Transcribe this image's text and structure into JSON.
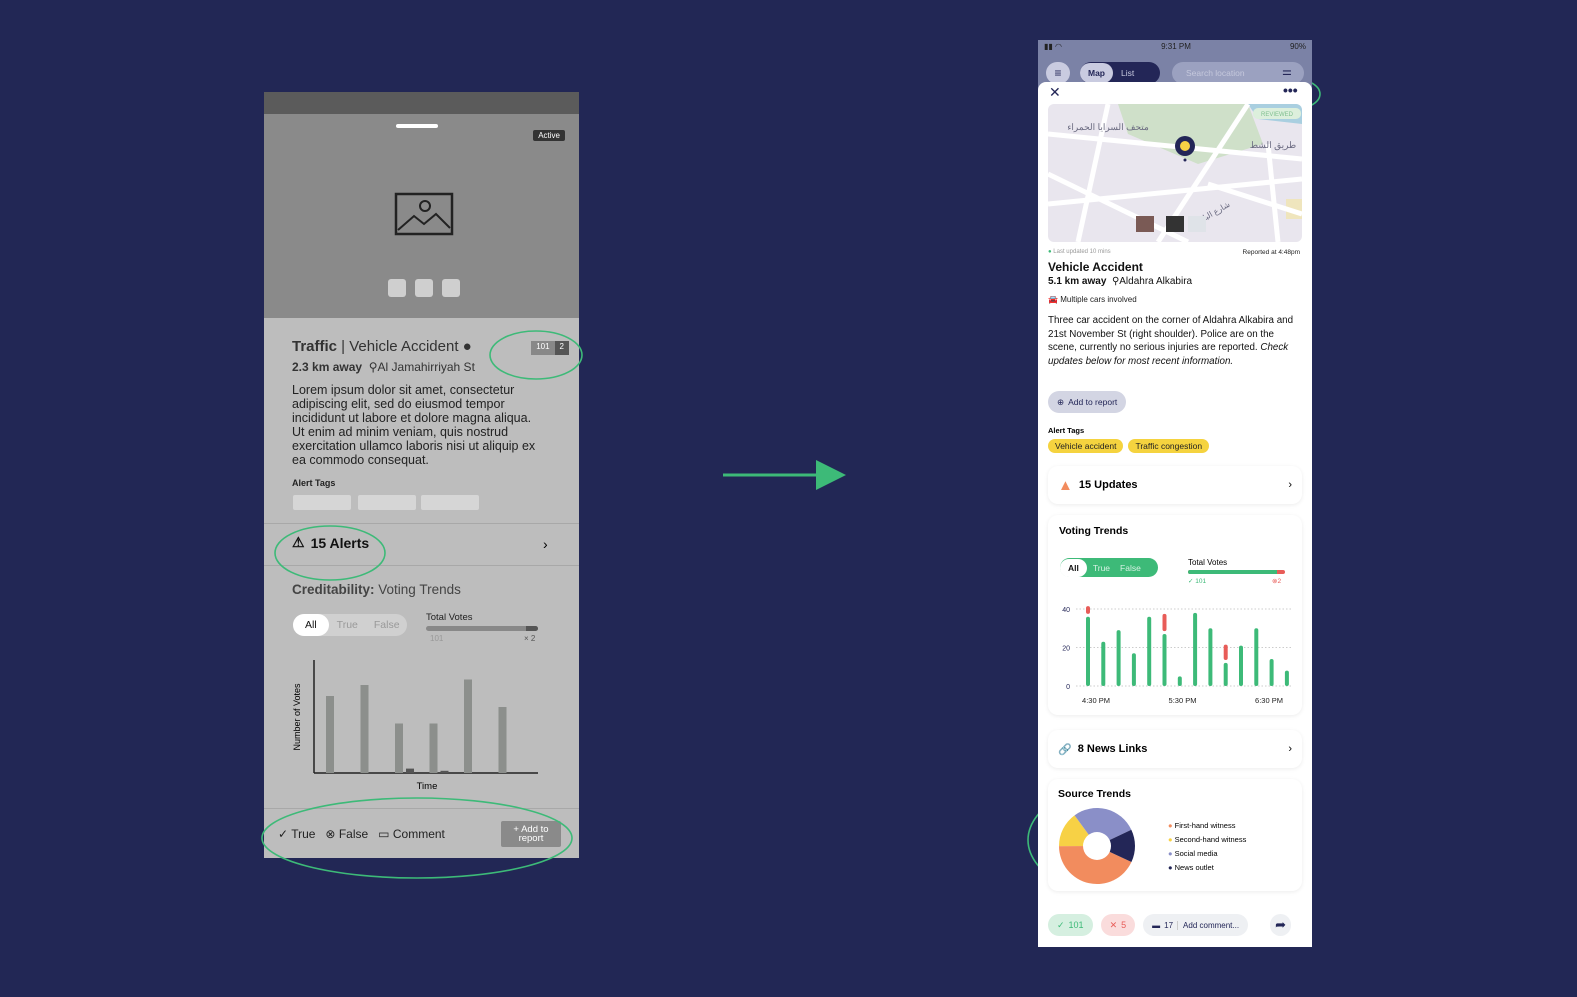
{
  "wireframe": {
    "status_badge": "Active",
    "category": "Traffic",
    "separator": " | ",
    "title": "Vehicle Accident",
    "true_votes": "101",
    "false_votes": "2",
    "distance": "2.3 km away",
    "location": "Al Jamahirriyah St",
    "body": "Lorem ipsum dolor sit amet, consectetur adipiscing elit, sed do eiusmod tempor incididunt ut labore et dolore magna aliqua. Ut enim ad minim veniam, quis nostrud exercitation ullamco laboris nisi ut aliquip ex ea commodo consequat.",
    "alert_tags_label": "Alert Tags",
    "alerts": "15 Alerts",
    "cred_label": "Creditability:",
    "cred_title": "Voting Trends",
    "segments": [
      "All",
      "True",
      "False"
    ],
    "total_votes": "Total Votes",
    "tv_true": "101",
    "tv_false": "× 2",
    "actions": {
      "true": "True",
      "false": "False",
      "comment": "Comment",
      "add": "+ Add to report"
    }
  },
  "chart_data": [
    {
      "type": "bar",
      "title": "",
      "xlabel": "Time",
      "ylabel": "Number of Votes",
      "series": [
        {
          "values": [
            70,
            80,
            45,
            45,
            85,
            60
          ]
        },
        {
          "values": [
            0,
            0,
            4,
            2,
            0,
            0
          ]
        }
      ]
    },
    {
      "type": "bar",
      "title": "Voting Trends",
      "ylim": [
        0,
        40
      ],
      "yticks": [
        0,
        20,
        40
      ],
      "xticks": [
        "4:30 PM",
        "5:30 PM",
        "6:30 PM"
      ],
      "series": [
        {
          "values": [
            36,
            23,
            29,
            17,
            36,
            27,
            5,
            38,
            30,
            12,
            21,
            30,
            14,
            8
          ],
          "color": "#3dba78"
        },
        {
          "values": [
            4,
            0,
            0,
            0,
            0,
            9,
            0,
            0,
            0,
            8,
            0,
            0,
            0,
            0
          ],
          "color": "#e85c58"
        }
      ]
    },
    {
      "type": "pie",
      "title": "Source Trends",
      "slices": [
        {
          "name": "First-hand witness",
          "value": 43,
          "color": "#f28c5e"
        },
        {
          "name": "Second-hand witness",
          "value": 15,
          "color": "#f7d145"
        },
        {
          "name": "Social media",
          "value": 28,
          "color": "#8a8fc8"
        },
        {
          "name": "News outlet",
          "value": 14,
          "color": "#232657"
        }
      ]
    }
  ],
  "app": {
    "time": "9:31 PM",
    "battery": "90%",
    "tabs": [
      "Map",
      "List"
    ],
    "search_placeholder": "Search location",
    "map_labels": [
      "متحف السرايا الحمراء",
      "طريق الشط",
      "شارع البلدية"
    ],
    "reviewed": "REVIEWED",
    "last_updated": "Last updated 10 mins",
    "reported": "Reported at 4:48pm",
    "title": "Vehicle Accident",
    "distance": "5.1 km away",
    "location": "Aldahra Alkabira",
    "cars": "Multiple cars involved",
    "body": "Three car accident on the corner of Aldahra Alkabira and 21st November St (right shoulder). Police are on the scene, currently no serious injuries are reported. ",
    "body_italic": "Check updates below for most recent information.",
    "add_report": "Add to report",
    "alert_tags_label": "Alert Tags",
    "tags": [
      "Vehicle accident",
      "Traffic congestion"
    ],
    "updates": "15 Updates",
    "voting_title": "Voting Trends",
    "segments": [
      "All",
      "True",
      "False"
    ],
    "total_votes": "Total Votes",
    "tv_true": "101",
    "tv_false": "2",
    "true_share": 0.92,
    "news": "8 News Links",
    "source_title": "Source Trends",
    "true_count": "101",
    "false_count": "5",
    "comments": "17",
    "comment_placeholder": "Add comment...",
    "accent": "#3dba78",
    "danger": "#e85c58",
    "navy": "#232657"
  }
}
